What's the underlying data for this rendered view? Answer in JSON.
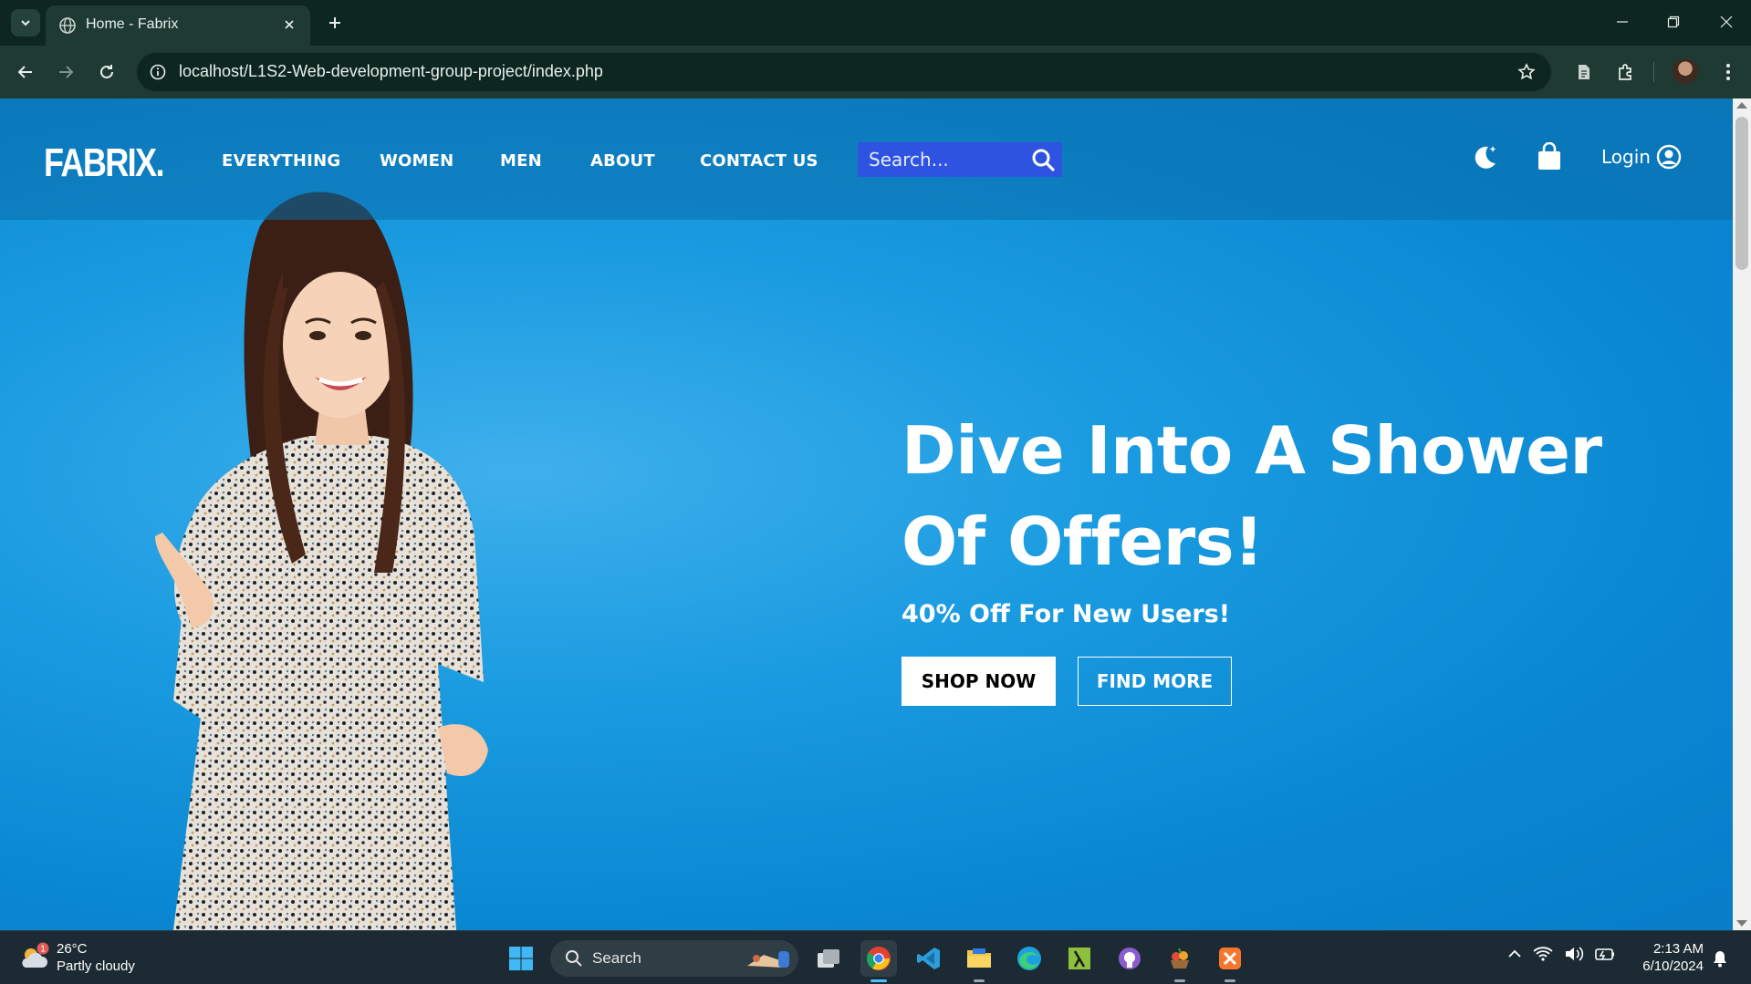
{
  "browser": {
    "tab_title": "Home - Fabrix",
    "url": "localhost/L1S2-Web-development-group-project/index.php"
  },
  "site": {
    "logo": "FABRIX.",
    "nav": [
      "EVERYTHING",
      "WOMEN",
      "MEN",
      "ABOUT",
      "CONTACT US"
    ],
    "search_placeholder": "Search...",
    "login_label": "Login"
  },
  "hero": {
    "headline": "Dive Into A Shower Of Offers!",
    "subline": "40% Off For New Users!",
    "primary_button": "SHOP NOW",
    "secondary_button": "FIND MORE"
  },
  "taskbar": {
    "weather_temp": "26°C",
    "weather_desc": "Partly cloudy",
    "weather_badge": "1",
    "search_label": "Search",
    "time": "2:13 AM",
    "date": "6/10/2024"
  },
  "colors": {
    "hero_blue": "#0a87d2",
    "search_bg": "#2e53e0",
    "chrome_bg": "#0d2620"
  }
}
